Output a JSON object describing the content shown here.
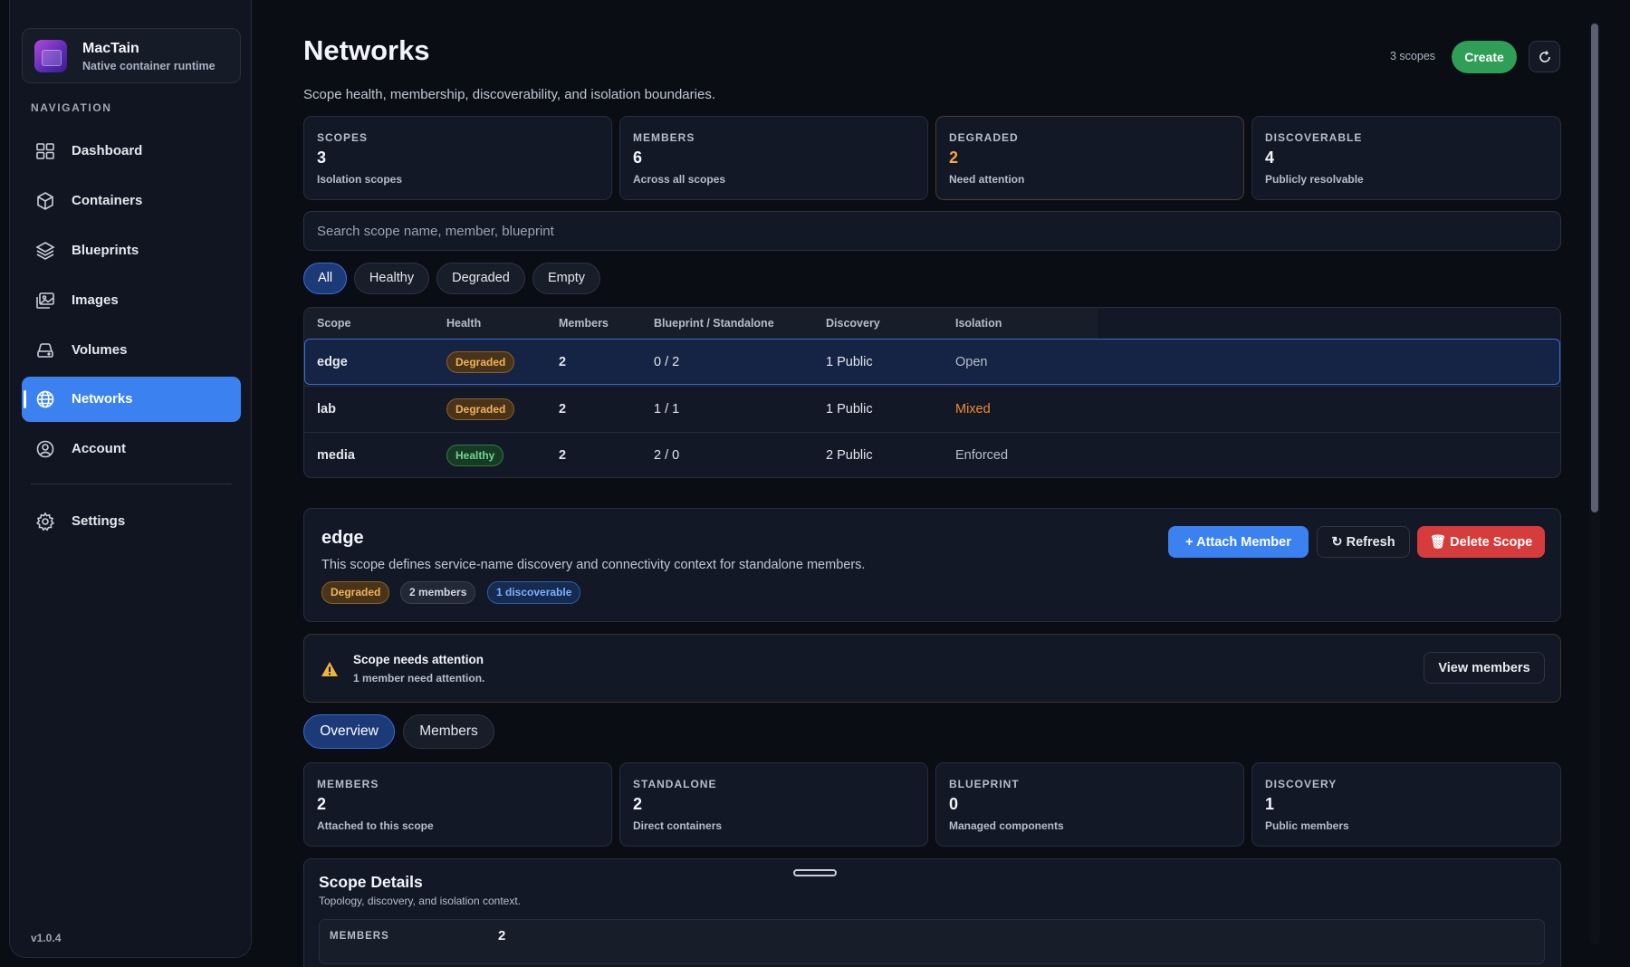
{
  "app": {
    "name": "MacTain",
    "subtitle": "Native container runtime",
    "version": "v1.0.4",
    "accent": "#3b82f0"
  },
  "sidebar": {
    "heading": "NAVIGATION",
    "items": [
      {
        "label": "Dashboard",
        "icon": "dashboard-icon"
      },
      {
        "label": "Containers",
        "icon": "cube-icon"
      },
      {
        "label": "Blueprints",
        "icon": "layers-icon"
      },
      {
        "label": "Images",
        "icon": "images-icon"
      },
      {
        "label": "Volumes",
        "icon": "drive-icon"
      },
      {
        "label": "Networks",
        "icon": "globe-icon",
        "active": true
      },
      {
        "label": "Account",
        "icon": "user-circle-icon"
      },
      {
        "label": "Settings",
        "icon": "gear-icon"
      }
    ]
  },
  "header": {
    "title": "Networks",
    "subtitle": "Scope health, membership, discoverability, and isolation boundaries.",
    "scope_count": "3 scopes",
    "create_label": "Create"
  },
  "stats": [
    {
      "key": "SCOPES",
      "value": "3",
      "desc": "Isolation scopes"
    },
    {
      "key": "MEMBERS",
      "value": "6",
      "desc": "Across all scopes"
    },
    {
      "key": "DEGRADED",
      "value": "2",
      "desc": "Need attention"
    },
    {
      "key": "DISCOVERABLE",
      "value": "4",
      "desc": "Publicly resolvable"
    }
  ],
  "search": {
    "placeholder": "Search scope name, member, blueprint"
  },
  "filters": [
    "All",
    "Healthy",
    "Degraded",
    "Empty"
  ],
  "table": {
    "columns": [
      "Scope",
      "Health",
      "Members",
      "Blueprint / Standalone",
      "Discovery",
      "Isolation"
    ],
    "rows": [
      {
        "scope": "edge",
        "health": "Degraded",
        "members": "2",
        "blueprint": "0 / 2",
        "discovery": "1 Public",
        "isolation": "Open"
      },
      {
        "scope": "lab",
        "health": "Degraded",
        "members": "2",
        "blueprint": "1 / 1",
        "discovery": "1 Public",
        "isolation": "Mixed"
      },
      {
        "scope": "media",
        "health": "Healthy",
        "members": "2",
        "blueprint": "2 / 0",
        "discovery": "2 Public",
        "isolation": "Enforced"
      }
    ]
  },
  "detail": {
    "title": "edge",
    "description": "This scope defines service-name discovery and connectivity context for standalone members.",
    "tags": {
      "health": "Degraded",
      "members": "2 members",
      "discoverable": "1 discoverable"
    },
    "attach_label": "Attach Member",
    "refresh_label": "Refresh",
    "delete_label": "Delete Scope"
  },
  "alert": {
    "title": "Scope needs attention",
    "description": "1 member need attention.",
    "action_label": "View members"
  },
  "tabs": [
    "Overview",
    "Members"
  ],
  "overview_stats": [
    {
      "key": "MEMBERS",
      "value": "2",
      "desc": "Attached to this scope"
    },
    {
      "key": "STANDALONE",
      "value": "2",
      "desc": "Direct containers"
    },
    {
      "key": "BLUEPRINT",
      "value": "0",
      "desc": "Managed components"
    },
    {
      "key": "DISCOVERY",
      "value": "1",
      "desc": "Public members"
    }
  ],
  "scope_details": {
    "title": "Scope Details",
    "subtitle": "Topology, discovery, and isolation context.",
    "rows": [
      {
        "key": "MEMBERS",
        "value": "2"
      }
    ]
  }
}
